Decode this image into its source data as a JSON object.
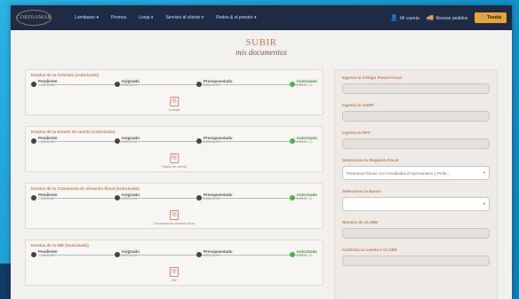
{
  "nav": {
    "logo": "CORDIAMAR",
    "menu": [
      "Lomitaseo ▾",
      "Promos",
      "Lonja ▾",
      "Servicio al cliente ▾",
      "Redes & el prestor ▾"
    ],
    "account": "Mi cuenta",
    "orders": "Revisar pedidos",
    "cart": "Tienda"
  },
  "page": {
    "title": "SUBIR",
    "subtitle": "mis documentos"
  },
  "cards": [
    {
      "title": "Estatus de tu Contrato (Autorizado)",
      "steps": [
        {
          "name": "Pendiente",
          "date": "2025-12-16"
        },
        {
          "name": "Asignado",
          "date": "2025-12-16"
        },
        {
          "name": "Presupuestado",
          "date": "2025-12-16"
        },
        {
          "name": "Autorizado",
          "date": "2025-12-16"
        }
      ],
      "doc": "Contrato"
    },
    {
      "title": "Estatus de tu Estado de cuenta (Autorizado)",
      "steps": [
        {
          "name": "Pendiente",
          "date": "2025-12-16"
        },
        {
          "name": "Asignado",
          "date": "2025-12-16"
        },
        {
          "name": "Presupuestado",
          "date": "2025-12-16"
        },
        {
          "name": "Autorizado",
          "date": "2025-12-16"
        }
      ],
      "doc": "Estado de cuenta"
    },
    {
      "title": "Estatus de tu Constancia de situación fiscal (Autorizado)",
      "steps": [
        {
          "name": "Pendiente",
          "date": "2025-12-16"
        },
        {
          "name": "Asignado",
          "date": "2025-12-16"
        },
        {
          "name": "Presupuestado",
          "date": "2025-12-16"
        },
        {
          "name": "Autorizado",
          "date": "2025-12-16"
        }
      ],
      "doc": "Constancia de situación fiscal"
    },
    {
      "title": "Estatus de tu INE (Autorizado)",
      "steps": [
        {
          "name": "Pendiente",
          "date": "2025-12-16"
        },
        {
          "name": "Asignado",
          "date": "2025-12-16"
        },
        {
          "name": "Presupuestado",
          "date": "2025-12-16"
        },
        {
          "name": "Autorizado",
          "date": "2025-12-16"
        }
      ],
      "doc": "INE"
    }
  ],
  "form": {
    "cp": "Ingresa tu Código Postal Fiscal",
    "curp": "Ingresa tu CURP",
    "rfc": "Ingresa tu RFC",
    "regimen": "Selecciona tu Regimen Fiscal",
    "regimen_value": "Personas Físicas con Actividades Empresariales y Profe...",
    "banco": "Selecciona tu Banco",
    "clabe": "Número de CLABE",
    "clabe_confirm": "Confirma tu cuenta o CLABE"
  }
}
